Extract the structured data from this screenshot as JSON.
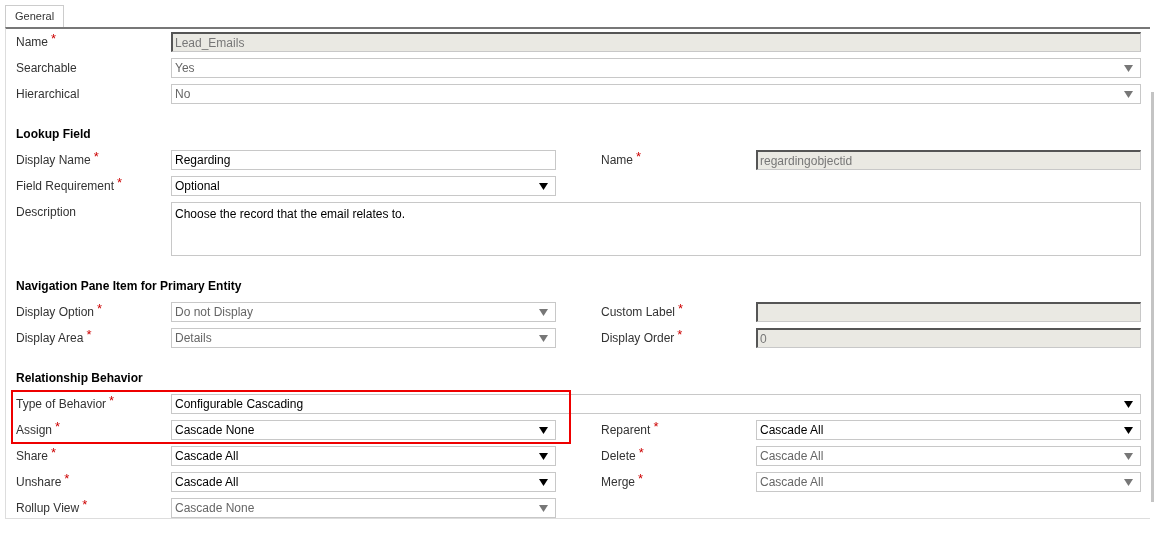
{
  "tabs": [
    {
      "label": "General",
      "selected": true
    }
  ],
  "sections": [
    {
      "rows": [
        {
          "kind": "full",
          "cells": [
            {
              "label": "Name",
              "marker": "*",
              "field": {
                "kind": "readonly",
                "value": "Lead_Emails"
              }
            }
          ]
        },
        {
          "kind": "full",
          "cells": [
            {
              "label": "Searchable",
              "field": {
                "kind": "select",
                "value": "Yes",
                "disabled": true
              }
            }
          ]
        },
        {
          "kind": "full",
          "cells": [
            {
              "label": "Hierarchical",
              "field": {
                "kind": "select",
                "value": "No",
                "disabled": true
              }
            }
          ]
        }
      ]
    },
    {
      "heading": "Lookup Field",
      "rows": [
        {
          "kind": "pair",
          "cells": [
            {
              "label": "Display Name",
              "marker": "*",
              "field": {
                "kind": "text",
                "value": "Regarding"
              }
            },
            {
              "label": "Name",
              "marker": "*",
              "field": {
                "kind": "readonly",
                "value": "regardingobjectid"
              }
            }
          ]
        },
        {
          "kind": "pair",
          "cells": [
            {
              "label": "Field Requirement",
              "marker": "*",
              "field": {
                "kind": "select",
                "value": "Optional",
                "disabled": false
              }
            }
          ]
        },
        {
          "kind": "full",
          "cells": [
            {
              "label": "Description",
              "field": {
                "kind": "textarea",
                "value": "Choose the record that the email relates to."
              }
            }
          ]
        }
      ]
    },
    {
      "heading": "Navigation Pane Item for Primary Entity",
      "rows": [
        {
          "kind": "pair",
          "cells": [
            {
              "label": "Display Option",
              "marker": "*",
              "field": {
                "kind": "select",
                "value": "Do not Display",
                "disabled": true
              }
            },
            {
              "label": "Custom Label",
              "marker": "*",
              "field": {
                "kind": "readonly"
              }
            }
          ]
        },
        {
          "kind": "pair",
          "cells": [
            {
              "label": "Display Area",
              "marker": "*",
              "field": {
                "kind": "select",
                "value": "Details",
                "disabled": true
              }
            },
            {
              "label": "Display Order",
              "marker": "*",
              "field": {
                "kind": "readonly",
                "value": "0"
              }
            }
          ]
        }
      ]
    },
    {
      "heading": "Relationship Behavior",
      "highlighted_rows": [
        {
          "kind": "full",
          "cells": [
            {
              "label": "Type of Behavior",
              "marker": "*",
              "field": {
                "kind": "select",
                "value": "Configurable Cascading",
                "disabled": false
              }
            }
          ]
        },
        {
          "kind": "pair",
          "cells": [
            {
              "label": "Assign",
              "marker": "*",
              "field": {
                "kind": "select",
                "value": "Cascade None",
                "disabled": false
              }
            },
            {
              "label": "Reparent",
              "marker": "*",
              "field": {
                "kind": "select",
                "value": "Cascade All",
                "disabled": false
              }
            }
          ]
        }
      ],
      "rows": [
        {
          "kind": "pair",
          "cells": [
            {
              "label": "Share",
              "marker": "*",
              "field": {
                "kind": "select",
                "value": "Cascade All",
                "disabled": false
              }
            },
            {
              "label": "Delete",
              "marker": "*",
              "field": {
                "kind": "select",
                "value": "Cascade All",
                "disabled": true
              }
            }
          ]
        },
        {
          "kind": "pair",
          "cells": [
            {
              "label": "Unshare",
              "marker": "*",
              "field": {
                "kind": "select",
                "value": "Cascade All",
                "disabled": false
              }
            },
            {
              "label": "Merge",
              "marker": "*",
              "field": {
                "kind": "select",
                "value": "Cascade All",
                "disabled": true
              }
            }
          ]
        },
        {
          "kind": "pair",
          "cells": [
            {
              "label": "Rollup View",
              "marker": "*",
              "field": {
                "kind": "select",
                "value": "Cascade None",
                "disabled": true
              }
            }
          ]
        }
      ]
    }
  ]
}
